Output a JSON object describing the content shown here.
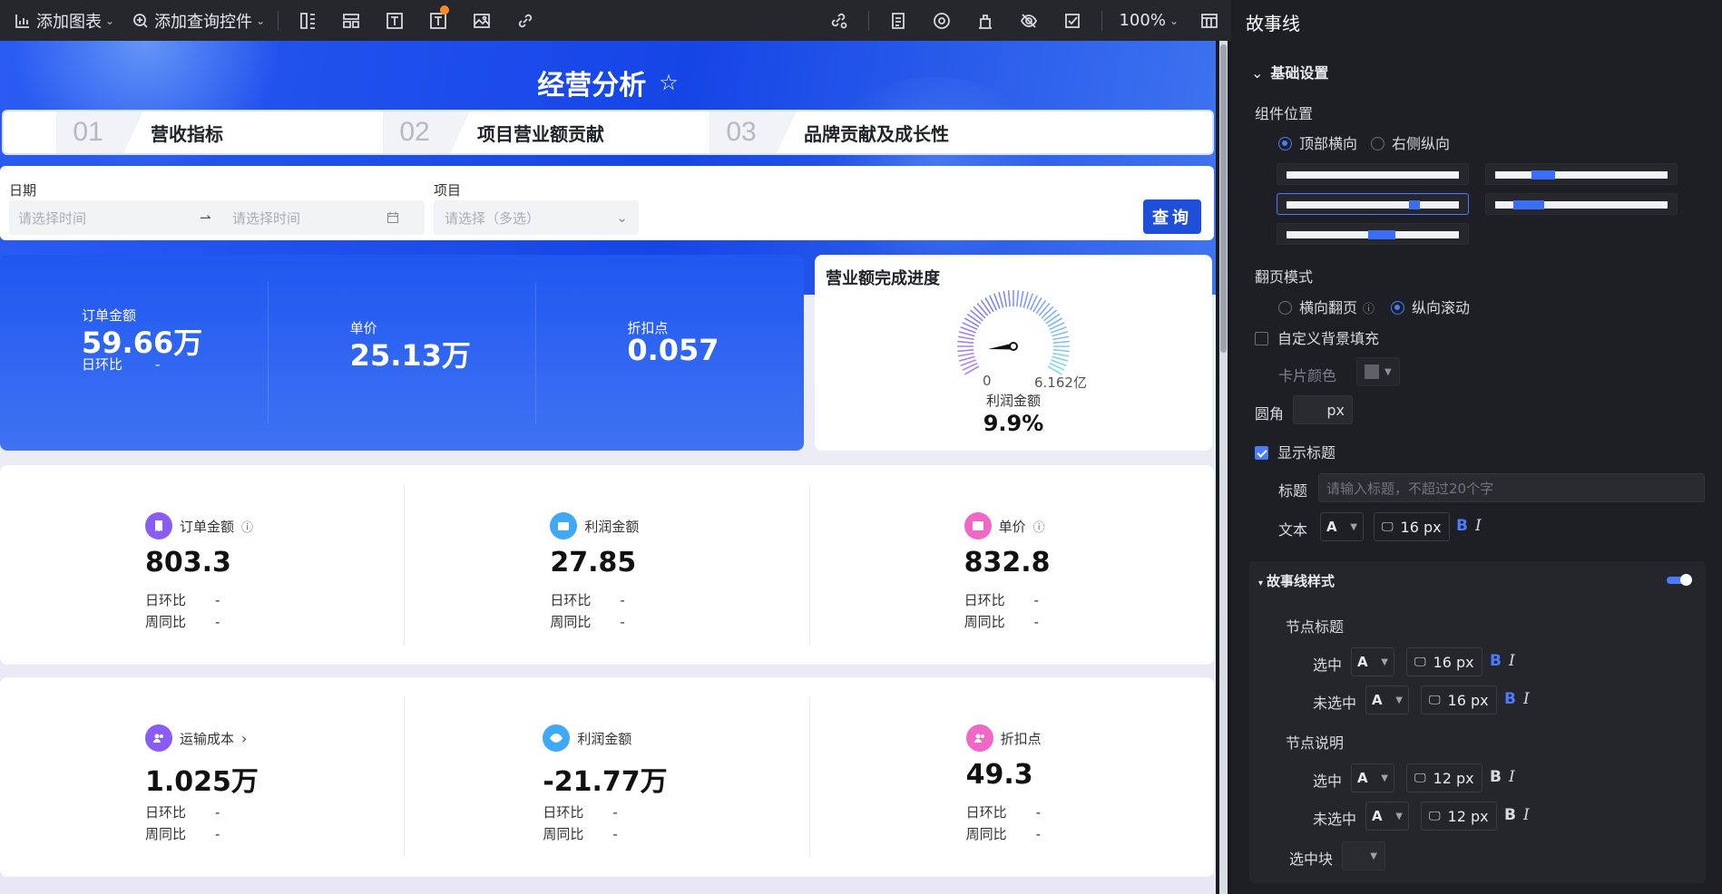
{
  "toolbar": {
    "add_chart": "添加图表",
    "add_query": "添加查询控件",
    "zoom": "100%"
  },
  "page": {
    "title": "经营分析"
  },
  "storyline": [
    {
      "num": "01",
      "label": "营收指标"
    },
    {
      "num": "02",
      "label": "项目营业额贡献"
    },
    {
      "num": "03",
      "label": "品牌贡献及成长性"
    }
  ],
  "filters": {
    "date_label": "日期",
    "date_start_placeholder": "请选择时间",
    "date_end_placeholder": "请选择时间",
    "project_label": "项目",
    "project_placeholder": "请选择（多选）",
    "query_button": "查询"
  },
  "kpi": [
    {
      "label": "订单金额",
      "value": "59.66万",
      "sub_label": "日环比",
      "sub_value": "-"
    },
    {
      "label": "单价",
      "value": "25.13万"
    },
    {
      "label": "折扣点",
      "value": "0.057"
    }
  ],
  "gauge": {
    "title": "营业额完成进度",
    "min": "0",
    "max": "6.162亿",
    "metric": "利润金额",
    "value": "9.9%",
    "fraction": 0.099
  },
  "metrics_row1": [
    {
      "label": "订单金额",
      "value": "803.3",
      "day": "日环比",
      "day_v": "-",
      "week": "周同比",
      "week_v": "-",
      "color": "#8a5cf6",
      "icon": "receipt-icon",
      "info": true
    },
    {
      "label": "利润金额",
      "value": "27.85",
      "day": "日环比",
      "day_v": "-",
      "week": "周同比",
      "week_v": "-",
      "color": "#3fa8f7",
      "icon": "wallet-icon"
    },
    {
      "label": "单价",
      "value": "832.8",
      "day": "日环比",
      "day_v": "-",
      "week": "周同比",
      "week_v": "-",
      "color": "#f067c7",
      "icon": "card-icon",
      "info": true
    }
  ],
  "metrics_row2": [
    {
      "label": "运输成本",
      "value": "1.025万",
      "day": "日环比",
      "day_v": "-",
      "week": "周同比",
      "week_v": "-",
      "color": "#8a5cf6",
      "icon": "users-icon",
      "chevron": true
    },
    {
      "label": "利润金额",
      "value": "-21.77万",
      "day": "日环比",
      "day_v": "-",
      "week": "周同比",
      "week_v": "-",
      "color": "#3fa8f7",
      "icon": "eye-icon"
    },
    {
      "label": "折扣点",
      "value": "49.3",
      "day": "日环比",
      "day_v": "-",
      "week": "周同比",
      "week_v": "-",
      "color": "#f067c7",
      "icon": "users-icon"
    }
  ],
  "panel": {
    "title": "故事线",
    "basic": "基础设置",
    "position_label": "组件位置",
    "pos_top": "顶部横向",
    "pos_right": "右侧纵向",
    "paging_label": "翻页模式",
    "paging_h": "横向翻页",
    "paging_v": "纵向滚动",
    "custom_bg": "自定义背景填充",
    "card_color": "卡片颜色",
    "radius_label": "圆角",
    "radius_unit": "px",
    "show_title": "显示标题",
    "title_label": "标题",
    "title_placeholder": "请输入标题，不超过20个字",
    "text_label": "文本",
    "text_size": "16 px",
    "story_style": "故事线样式",
    "node_title": "节点标题",
    "selected": "选中",
    "unselected": "未选中",
    "node_title_sel_size": "16 px",
    "node_title_unsel_size": "16 px",
    "node_desc": "节点说明",
    "node_desc_sel_size": "12 px",
    "node_desc_unsel_size": "12 px",
    "sel_block": "选中块",
    "font_glyph": "A",
    "bold": "B",
    "italic": "I"
  },
  "colors": {
    "accent": "#1d4fd9",
    "panel_bg": "#1e1f25",
    "link_blue": "#4b7bff"
  }
}
